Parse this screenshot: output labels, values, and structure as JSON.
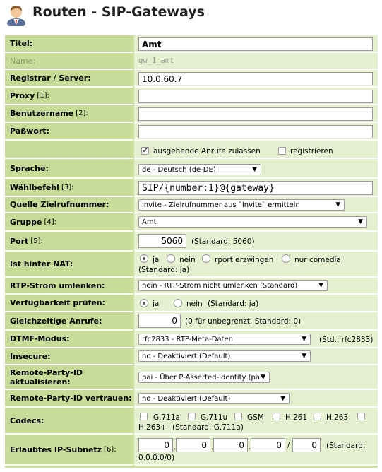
{
  "header": {
    "title": "Routen - SIP-Gateways",
    "icon": "user-avatar-icon"
  },
  "rows": {
    "titel": {
      "label": "Titel:",
      "value": "Amt"
    },
    "name": {
      "label": "Name:",
      "value": "gw_1_amt"
    },
    "registrar": {
      "label": "Registrar / Server:",
      "value": "10.0.60.7"
    },
    "proxy": {
      "label": "Proxy",
      "ref": "[1]:",
      "value": ""
    },
    "benutzername": {
      "label": "Benutzername",
      "ref": "[2]:",
      "value": ""
    },
    "passwort": {
      "label": "Paßwort:",
      "value": ""
    },
    "flags": {
      "outgoing_label": "ausgehende Anrufe zulassen",
      "outgoing_checked": true,
      "register_label": "registrieren",
      "register_checked": false
    },
    "sprache": {
      "label": "Sprache:",
      "selected": "de - Deutsch (de-DE)"
    },
    "waehlbefehl": {
      "label": "Wählbefehl",
      "ref": "[3]:",
      "value": "SIP/{number:1}@{gateway}"
    },
    "quelle": {
      "label": "Quelle Zielrufnummer:",
      "selected": "invite - Zielrufnummer aus `Invite` ermitteln"
    },
    "gruppe": {
      "label": "Gruppe",
      "ref": "[4]:",
      "selected": "Amt"
    },
    "port": {
      "label": "Port",
      "ref": "[5]:",
      "value": "5060",
      "hint": "(Standard: 5060)"
    },
    "nat": {
      "label": "Ist hinter NAT:",
      "options": [
        "ja",
        "nein",
        "rport erzwingen",
        "nur comedia"
      ],
      "selected": "ja",
      "hint": "(Standard: ja)"
    },
    "rtp": {
      "label": "RTP-Strom umlenken:",
      "selected": "nein - RTP-Strom nicht umlenken (Standard)"
    },
    "verfuegbarkeit": {
      "label": "Verfügbarkeit prüfen:",
      "options": [
        "ja",
        "nein"
      ],
      "selected": "ja",
      "hint": "(Standard: ja)"
    },
    "gleichzeitig": {
      "label": "Gleichzeitige Anrufe:",
      "value": "0",
      "hint": "(0 für unbegrenzt, Standard: 0)"
    },
    "dtmf": {
      "label": "DTMF-Modus:",
      "selected": "rfc2833 - RTP-Meta-Daten",
      "hint": "(Std.: rfc2833)"
    },
    "insecure": {
      "label": "Insecure:",
      "selected": "no - Deaktiviert (Default)"
    },
    "rpid_update": {
      "label_line1": "Remote-Party-ID",
      "label_line2": "aktualisieren:",
      "selected": "pai - Über P-Asserted-Identity (pai)"
    },
    "rpid_trust": {
      "label": "Remote-Party-ID vertrauen:",
      "selected": "no - Deaktiviert (Default)"
    },
    "codecs": {
      "label": "Codecs:",
      "items": [
        "G.711a",
        "G.711u",
        "GSM",
        "H.261",
        "H.263",
        "H.263+"
      ],
      "hint": "(Standard: G.711a)"
    },
    "subnetz": {
      "label": "Erlaubtes IP-Subnetz",
      "ref": "[6]:",
      "octets": [
        "0",
        "0",
        "0",
        "0"
      ],
      "mask": "0",
      "hint_line1": "(Standard:",
      "hint_line2": "0.0.0.0/0)"
    }
  },
  "colors": {
    "label_bg": "#c8dc9a",
    "value_bg": "#e6efcf"
  }
}
